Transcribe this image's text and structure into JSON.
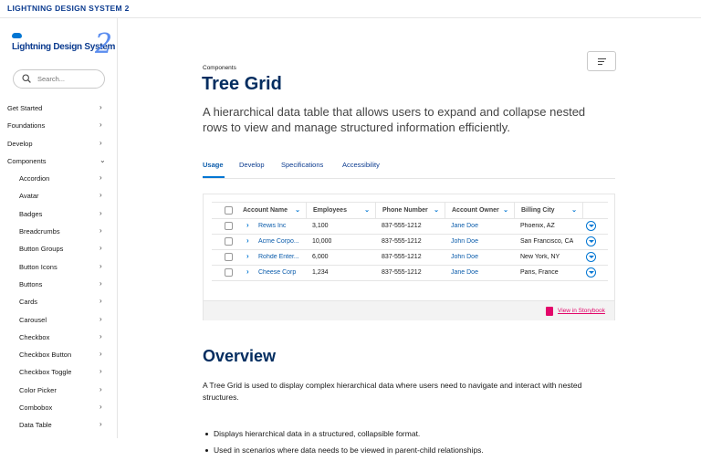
{
  "brand": "LIGHTNING DESIGN SYSTEM 2",
  "logo": {
    "text": "Lightning Design System",
    "numeral": "2"
  },
  "search": {
    "placeholder": "Search..."
  },
  "nav": {
    "top_items": [
      "Get Started",
      "Foundations",
      "Develop",
      "Components"
    ],
    "component_items": [
      "Accordion",
      "Avatar",
      "Badges",
      "Breadcrumbs",
      "Button Groups",
      "Button Icons",
      "Buttons",
      "Cards",
      "Carousel",
      "Checkbox",
      "Checkbox Button",
      "Checkbox Toggle",
      "Color Picker",
      "Combobox",
      "Data Table"
    ]
  },
  "page": {
    "eyebrow": "Components",
    "title": "Tree Grid",
    "subtitle": "A hierarchical data table that allows users to expand and collapse nested rows to view and manage structured information efficiently."
  },
  "tabs": [
    "Usage",
    "Develop",
    "Specifications",
    "Accessibility"
  ],
  "grid": {
    "columns": [
      "Account Name",
      "Employees",
      "Phone Number",
      "Account Owner",
      "Billing City"
    ],
    "rows": [
      [
        "Rewis Inc",
        "3,100",
        "837-555-1212",
        "Jane Doe",
        "Phoenix, AZ"
      ],
      [
        "Acme Corpo...",
        "10,000",
        "837-555-1212",
        "John Doe",
        "San Francisco, CA"
      ],
      [
        "Rohde Enter...",
        "6,000",
        "837-555-1212",
        "John Doe",
        "New York, NY"
      ],
      [
        "Cheese Corp",
        "1,234",
        "837-555-1212",
        "Jane Doe",
        "Paris, France"
      ]
    ]
  },
  "storybook_link": "View in Storybook",
  "overview": {
    "title": "Overview",
    "paragraph": "A Tree Grid is used to display complex hierarchical data where users need to navigate and interact with nested structures.",
    "bullets": [
      "Displays hierarchical data in a structured, collapsible format.",
      "Used in scenarios where data needs to be viewed in parent-child relationships."
    ]
  },
  "colors": {
    "brand_blue": "#032d60",
    "link_blue": "#0b5cab",
    "accent": "#0176d3",
    "storybook": "#e3066a"
  },
  "icons": {
    "search": "search-icon",
    "menu": "menu-lines-icon",
    "chevron": "chevron-right-icon"
  }
}
